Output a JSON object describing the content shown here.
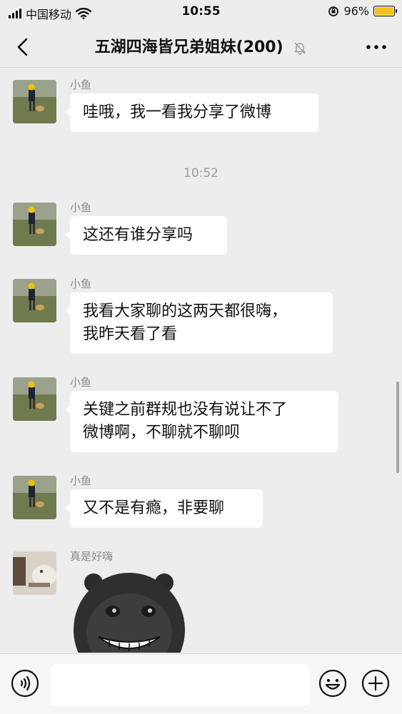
{
  "status_bar": {
    "carrier": "中国移动",
    "time": "10:55",
    "battery": "96%"
  },
  "header": {
    "title": "五湖四海皆兄弟姐妹(200)"
  },
  "messages": [
    {
      "sender": "小鱼",
      "text": "哇哦，我一看我分享了微博"
    },
    {
      "time": "10:52"
    },
    {
      "sender": "小鱼",
      "text": "这还有谁分享吗"
    },
    {
      "sender": "小鱼",
      "lines": [
        "我看大家聊的这两天都很嗨，",
        "我昨天看了看"
      ]
    },
    {
      "sender": "小鱼",
      "lines": [
        "关键之前群规也没有说让不了",
        "微博啊，不聊就不聊呗"
      ]
    },
    {
      "sender": "小鱼",
      "text": "又不是有瘾，非要聊"
    },
    {
      "sender": "真是好嗨",
      "sticker": "black-pig-grin-sticker"
    }
  ],
  "icons": {
    "back": "chevron-left-icon",
    "mute": "muted-bell-icon",
    "more": "more-dots-icon",
    "voice": "voice-icon",
    "emoji": "emoji-icon",
    "plus": "plus-icon"
  },
  "colors": {
    "background": "#ededed",
    "bubble": "#ffffff",
    "battery": "#f4c21d",
    "sender": "#8a8a8a"
  }
}
